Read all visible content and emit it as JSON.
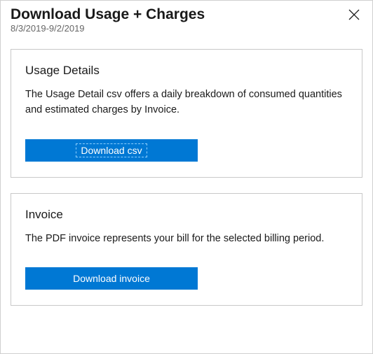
{
  "panel": {
    "title": "Download Usage + Charges",
    "date_range": "8/3/2019-9/2/2019"
  },
  "sections": {
    "usage": {
      "title": "Usage Details",
      "desc": "The Usage Detail csv offers a daily breakdown of consumed quantities and estimated charges by Invoice.",
      "button_label": "Download csv"
    },
    "invoice": {
      "title": "Invoice",
      "desc": "The PDF invoice represents your bill for the selected billing period.",
      "button_label": "Download invoice"
    }
  }
}
